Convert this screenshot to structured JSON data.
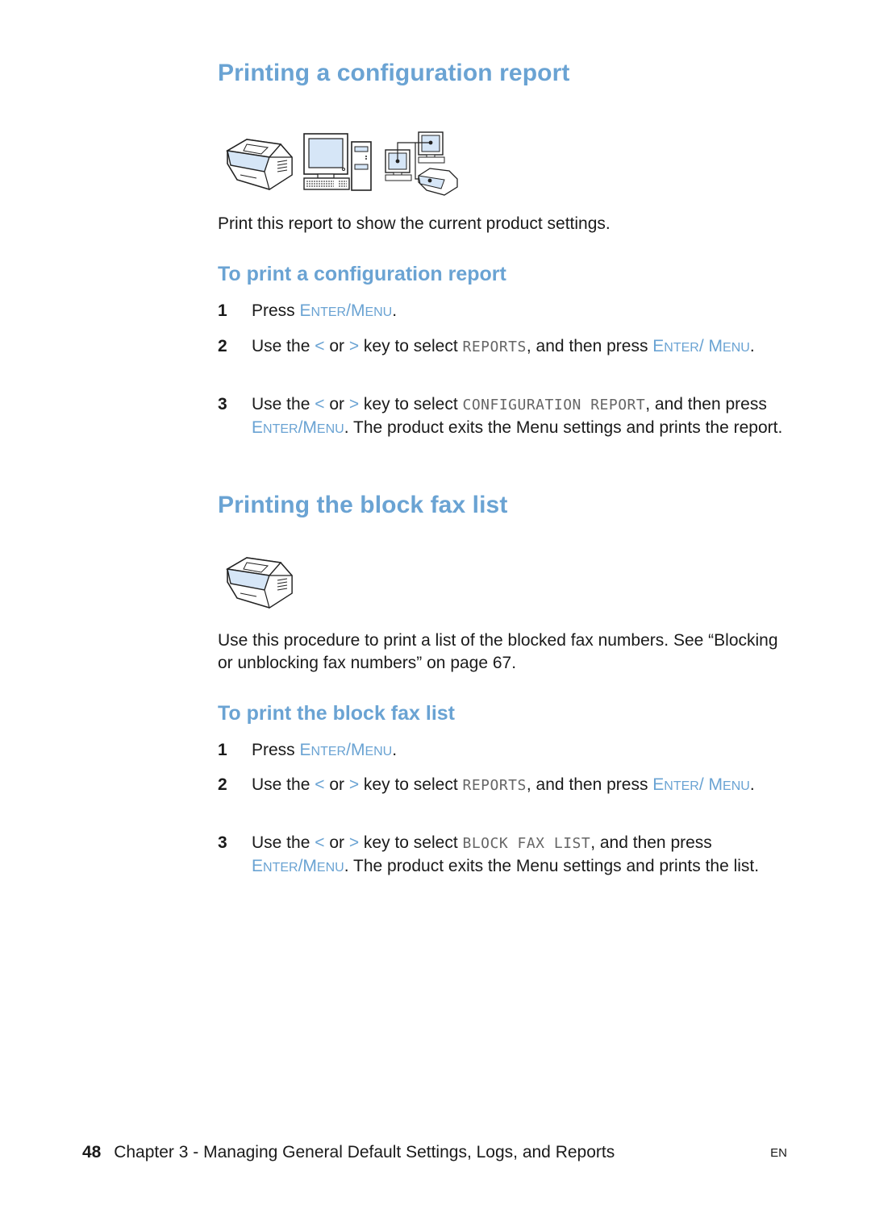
{
  "section1": {
    "title": "Printing a configuration report",
    "icons": [
      "fax-machine-icon",
      "desktop-computer-icon",
      "network-icon"
    ],
    "intro": "Print this report to show the current product settings.",
    "subtitle": "To print a configuration report",
    "steps": [
      {
        "num": "1",
        "t1": "Press ",
        "key_e": "E",
        "key_nter": "NTER",
        "key_slash": "/",
        "key_m": "M",
        "key_enu": "ENU",
        "t2": "."
      },
      {
        "num": "2",
        "t1": "Use the ",
        "lt": "<",
        "t2": " or ",
        "gt": ">",
        "t3": " key to select ",
        "lcd": "REPORTS",
        "t4": ", and then press ",
        "key_e": "E",
        "key_nter": "NTER",
        "key_slash": "/",
        "key_m": "M",
        "key_enu": "ENU",
        "t5": "."
      },
      {
        "num": "3",
        "t1": "Use the ",
        "lt": "<",
        "t2": " or ",
        "gt": ">",
        "t3": " key to select ",
        "lcd": "CONFIGURATION REPORT",
        "t4": ", and then press ",
        "key_e": "E",
        "key_nter": "NTER",
        "key_slash": "/",
        "key_m": "M",
        "key_enu": "ENU",
        "t5": ". The product exits the Menu settings and prints the report."
      }
    ]
  },
  "section2": {
    "title": "Printing the block fax list",
    "icons": [
      "fax-machine-icon"
    ],
    "intro": "Use this procedure to print a list of the blocked fax numbers. See “Blocking or unblocking fax numbers” on page 67.",
    "subtitle": "To print the block fax list",
    "steps": [
      {
        "num": "1",
        "t1": "Press ",
        "key_e": "E",
        "key_nter": "NTER",
        "key_slash": "/",
        "key_m": "M",
        "key_enu": "ENU",
        "t2": "."
      },
      {
        "num": "2",
        "t1": "Use the ",
        "lt": "<",
        "t2": " or ",
        "gt": ">",
        "t3": " key to select ",
        "lcd": "REPORTS",
        "t4": ", and then press ",
        "key_e": "E",
        "key_nter": "NTER",
        "key_slash": "/",
        "key_m": "M",
        "key_enu": "ENU",
        "t5": "."
      },
      {
        "num": "3",
        "t1": "Use the ",
        "lt": "<",
        "t2": " or ",
        "gt": ">",
        "t3": " key to select ",
        "lcd": "BLOCK FAX LIST",
        "t4": ", and then press ",
        "key_e": "E",
        "key_nter": "NTER",
        "key_slash": "/",
        "key_m": "M",
        "key_enu": "ENU",
        "t5": ". The product exits the Menu settings and prints the list."
      }
    ]
  },
  "footer": {
    "page_number": "48",
    "chapter": "Chapter 3 - Managing General Default Settings, Logs, and Reports",
    "language": "EN"
  },
  "colors": {
    "heading": "#6aa3d3",
    "body_text": "#1a1a1a",
    "lcd_text": "#666666",
    "icon_fill": "#d6e6f7"
  }
}
